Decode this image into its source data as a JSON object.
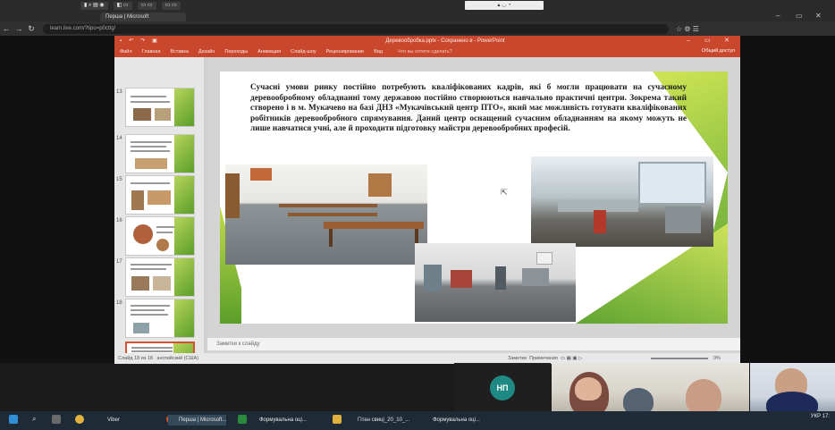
{
  "browser": {
    "url": "learn.live.com/?tipo=p0cttg/",
    "tab_title": "Перша | Microsoft"
  },
  "powerpoint": {
    "title": "Деревообробка.pptx - Сохранено в - PowerPoint",
    "ribbon_tabs": [
      "Файл",
      "Главная",
      "Вставка",
      "Дизайн",
      "Переходы",
      "Анимация",
      "Слайд-шоу",
      "Рецензирование",
      "Вид"
    ],
    "tell_me": "Что вы хотите сделать?",
    "share": "Общий доступ",
    "thumb_numbers": [
      "13",
      "14",
      "15",
      "16",
      "17",
      "18"
    ],
    "slide_text": "Сучасні умови ринку постійно потребують кваліфікованих кадрів, які б могли працювати на сучасному деревообробному обладнанні тому державою постійно створюються навчально практичні центри. Зокрема такий створено і в м. Мукачево на базі ДНЗ «Мукачівський центр ПТО», який має можливість готувати кваліфікованих робітників деревообробного спрямування. Даний центр оснащений сучасним обладнанням на якому можуть не лише навчатися учні, але й проходити підготовку майстри деревообробних професій.",
    "notes_placeholder": "Заметки к слайду",
    "status_left": "Слайд 18 из 18",
    "status_lang": "английский (США)",
    "status_notes": "Заметки",
    "status_comments": "Примечания",
    "zoom": "0%"
  },
  "meeting": {
    "initials": "НП"
  },
  "taskbar": {
    "items": [
      "Viber",
      "Перша | Microsoft...",
      "Формувальна оці...",
      "Гітан свиці_20_10_...",
      "Формувальна оці..."
    ],
    "time": "17:",
    "lang": "УКР"
  }
}
